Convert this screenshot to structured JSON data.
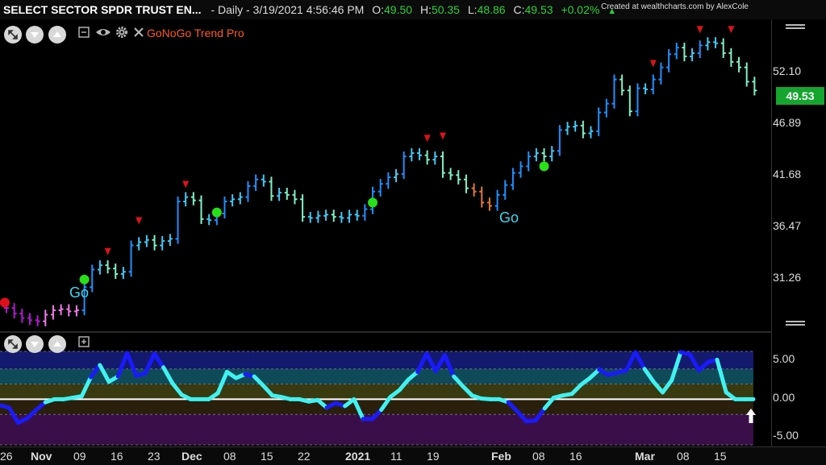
{
  "header": {
    "symbol": "SELECT SECTOR SPDR TRUST EN...",
    "interval": "- Daily - 3/19/2021 4:56:46 PM",
    "open_label": "O:",
    "open": "49.50",
    "high_label": "H:",
    "high": "50.35",
    "low_label": "L:",
    "low": "48.86",
    "close_label": "C:",
    "close": "49.53",
    "change": "+0.02%",
    "credit": "Created at wealthcharts.com by AlexCole"
  },
  "indicator": {
    "title": "GoNoGo Trend Pro"
  },
  "price_axis": {
    "labels": [
      "52.10",
      "46.89",
      "41.68",
      "36.47",
      "31.26"
    ],
    "last_price": "49.53",
    "last_price_color": "#16a52f"
  },
  "oscillator_axis": {
    "labels": [
      "5.00",
      "0.00",
      "-5.00"
    ]
  },
  "x_axis": [
    "26",
    "Nov",
    "09",
    "16",
    "23",
    "Dec",
    "08",
    "15",
    "22",
    "2021",
    "11",
    "19",
    "Feb",
    "08",
    "16",
    "Mar",
    "08",
    "15"
  ],
  "annotations": {
    "go_labels": [
      "Go",
      "Go"
    ]
  },
  "icons": [
    "expand-icon",
    "scroll-down-icon",
    "scroll-up-icon",
    "minimize-icon",
    "eye-icon",
    "gear-icon",
    "close-icon",
    "add-panel-icon",
    "up-arrow-icon"
  ],
  "colors": {
    "bullish_strong": "#1e90ff",
    "bullish": "#3fc8f2",
    "bullish_weak": "#7ff0c8",
    "bearish": "#b01ad0",
    "bearish_weak": "#f07ae8",
    "neutral": "#e07a30",
    "go_dot": "#27e018",
    "down_arrow": "#e0101a",
    "osc_strong": "#1a1aff",
    "osc_weak": "#3ff2f2"
  },
  "chart_data": {
    "type": "ohlc",
    "title": "",
    "y_range": [
      28.4,
      54.8
    ],
    "price_bars": [
      {
        "x": 0,
        "c": 29.7
      },
      {
        "x": 1,
        "c": 29.2
      },
      {
        "x": 2,
        "c": 28.8
      },
      {
        "x": 3,
        "c": 28.6
      },
      {
        "x": 4,
        "c": 28.5
      },
      {
        "x": 5,
        "c": 29.1
      },
      {
        "x": 6,
        "c": 29.5
      },
      {
        "x": 7,
        "c": 29.6
      },
      {
        "x": 8,
        "c": 29.4
      },
      {
        "x": 9,
        "c": 29.5
      },
      {
        "x": 10,
        "c": 31.6
      },
      {
        "x": 11,
        "c": 33.2
      },
      {
        "x": 12,
        "c": 33.6
      },
      {
        "x": 13,
        "c": 33.3
      },
      {
        "x": 14,
        "c": 32.8
      },
      {
        "x": 15,
        "c": 33.0
      },
      {
        "x": 16,
        "c": 35.4
      },
      {
        "x": 17,
        "c": 35.7
      },
      {
        "x": 18,
        "c": 35.9
      },
      {
        "x": 19,
        "c": 35.4
      },
      {
        "x": 20,
        "c": 35.8
      },
      {
        "x": 21,
        "c": 36.0
      },
      {
        "x": 22,
        "c": 39.4
      },
      {
        "x": 23,
        "c": 39.8
      },
      {
        "x": 24,
        "c": 39.5
      },
      {
        "x": 25,
        "c": 37.8
      },
      {
        "x": 26,
        "c": 37.7
      },
      {
        "x": 27,
        "c": 38.3
      },
      {
        "x": 28,
        "c": 39.4
      },
      {
        "x": 29,
        "c": 39.6
      },
      {
        "x": 30,
        "c": 39.8
      },
      {
        "x": 31,
        "c": 40.8
      },
      {
        "x": 32,
        "c": 41.4
      },
      {
        "x": 33,
        "c": 41.2
      },
      {
        "x": 34,
        "c": 39.9
      },
      {
        "x": 35,
        "c": 40.2
      },
      {
        "x": 36,
        "c": 40.0
      },
      {
        "x": 37,
        "c": 39.6
      },
      {
        "x": 38,
        "c": 38.0
      },
      {
        "x": 39,
        "c": 37.9
      },
      {
        "x": 40,
        "c": 38.1
      },
      {
        "x": 41,
        "c": 38.2
      },
      {
        "x": 42,
        "c": 38.0
      },
      {
        "x": 43,
        "c": 37.9
      },
      {
        "x": 44,
        "c": 38.2
      },
      {
        "x": 45,
        "c": 38.1
      },
      {
        "x": 46,
        "c": 38.7
      },
      {
        "x": 47,
        "c": 40.3
      },
      {
        "x": 48,
        "c": 41.0
      },
      {
        "x": 49,
        "c": 41.6
      },
      {
        "x": 50,
        "c": 41.9
      },
      {
        "x": 51,
        "c": 43.5
      },
      {
        "x": 52,
        "c": 43.8
      },
      {
        "x": 53,
        "c": 43.6
      },
      {
        "x": 54,
        "c": 43.2
      },
      {
        "x": 55,
        "c": 43.5
      },
      {
        "x": 56,
        "c": 42.0
      },
      {
        "x": 57,
        "c": 41.8
      },
      {
        "x": 58,
        "c": 41.4
      },
      {
        "x": 59,
        "c": 40.6
      },
      {
        "x": 60,
        "c": 40.3
      },
      {
        "x": 61,
        "c": 39.3
      },
      {
        "x": 62,
        "c": 39.0
      },
      {
        "x": 63,
        "c": 40.0
      },
      {
        "x": 64,
        "c": 40.9
      },
      {
        "x": 65,
        "c": 42.0
      },
      {
        "x": 66,
        "c": 42.6
      },
      {
        "x": 67,
        "c": 43.5
      },
      {
        "x": 68,
        "c": 43.8
      },
      {
        "x": 69,
        "c": 43.5
      },
      {
        "x": 70,
        "c": 44.0
      },
      {
        "x": 71,
        "c": 45.9
      },
      {
        "x": 72,
        "c": 46.2
      },
      {
        "x": 73,
        "c": 46.3
      },
      {
        "x": 74,
        "c": 45.6
      },
      {
        "x": 75,
        "c": 45.8
      },
      {
        "x": 76,
        "c": 47.5
      },
      {
        "x": 77,
        "c": 48.3
      },
      {
        "x": 78,
        "c": 50.5
      },
      {
        "x": 79,
        "c": 49.5
      },
      {
        "x": 80,
        "c": 47.6
      },
      {
        "x": 81,
        "c": 49.7
      },
      {
        "x": 82,
        "c": 49.6
      },
      {
        "x": 83,
        "c": 50.5
      },
      {
        "x": 84,
        "c": 51.6
      },
      {
        "x": 85,
        "c": 52.8
      },
      {
        "x": 86,
        "c": 53.4
      },
      {
        "x": 87,
        "c": 52.6
      },
      {
        "x": 88,
        "c": 52.9
      },
      {
        "x": 89,
        "c": 53.6
      },
      {
        "x": 90,
        "c": 53.9
      },
      {
        "x": 91,
        "c": 53.8
      },
      {
        "x": 92,
        "c": 52.9
      },
      {
        "x": 93,
        "c": 52.1
      },
      {
        "x": 94,
        "c": 51.6
      },
      {
        "x": 95,
        "c": 50.3
      },
      {
        "x": 96,
        "c": 49.5
      }
    ],
    "oscillator": [
      -0.8,
      -1.1,
      -3.1,
      -2.5,
      -1.4,
      -0.4,
      0.0,
      0.0,
      0.2,
      0.4,
      2.9,
      4.5,
      2.3,
      3.0,
      6.1,
      3.1,
      3.4,
      6.0,
      4.2,
      2.1,
      0.6,
      0.0,
      0.0,
      0.0,
      0.8,
      3.6,
      2.8,
      3.3,
      3.0,
      1.8,
      0.5,
      0.3,
      0.0,
      0.0,
      -0.3,
      -0.1,
      -1.1,
      -0.5,
      -0.9,
      0.0,
      -2.6,
      -2.6,
      -1.4,
      0.3,
      1.2,
      2.6,
      3.6,
      6.0,
      3.7,
      5.8,
      3.0,
      1.7,
      0.5,
      0.1,
      0.0,
      0.0,
      -0.4,
      -1.6,
      -2.9,
      -2.8,
      -1.2,
      0.2,
      0.5,
      0.7,
      1.9,
      2.8,
      3.9,
      3.2,
      3.5,
      3.8,
      6.2,
      4.0,
      2.3,
      0.9,
      2.5,
      6.2,
      5.9,
      3.8,
      4.9,
      5.2,
      0.9,
      0.0,
      0.0,
      0.0
    ],
    "oscillator_range": [
      -6.0,
      6.3
    ],
    "go_dots": [
      {
        "x": 10,
        "price": 32.3
      },
      {
        "x": 27,
        "price": 38.4
      },
      {
        "x": 47,
        "price": 39.3
      },
      {
        "x": 69,
        "price": 42.6
      }
    ],
    "down_triangles": [
      {
        "x": 13,
        "price": 34.8
      },
      {
        "x": 17,
        "price": 37.6
      },
      {
        "x": 23,
        "price": 40.9
      },
      {
        "x": 54,
        "price": 45.1
      },
      {
        "x": 56,
        "price": 45.3
      },
      {
        "x": 83,
        "price": 51.9
      },
      {
        "x": 89,
        "price": 55.0
      },
      {
        "x": 93,
        "price": 55.0
      }
    ]
  }
}
